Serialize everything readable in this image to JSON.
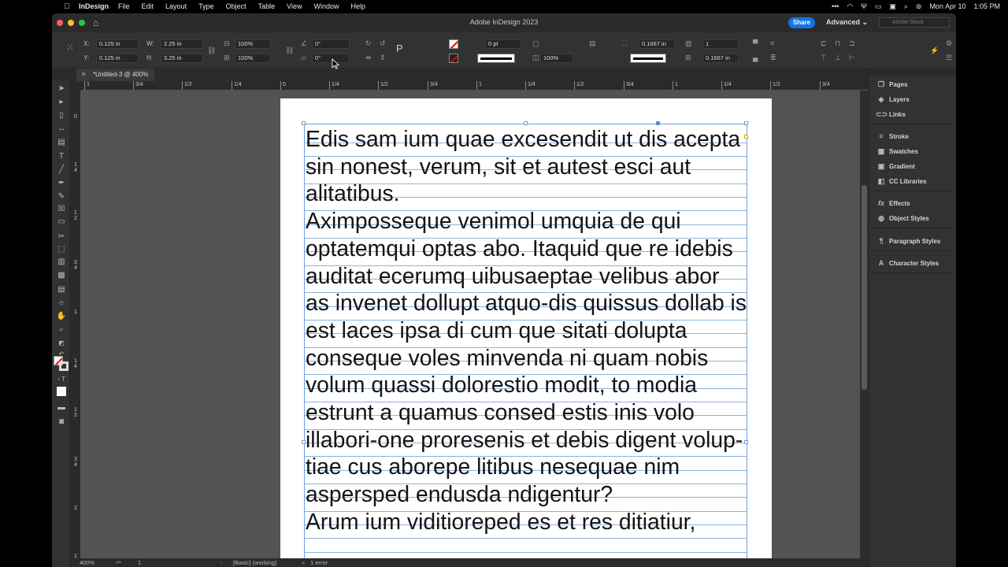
{
  "menubar": {
    "apple": "",
    "app": "InDesign",
    "items": [
      "File",
      "Edit",
      "Layout",
      "Type",
      "Object",
      "Table",
      "View",
      "Window",
      "Help"
    ],
    "clock": "Mon Apr 10",
    "time": "1:05 PM",
    "status_icons": [
      "more-icon",
      "wifi-icon",
      "airdrop-icon",
      "battery-icon",
      "screen-icon",
      "search-icon",
      "control-center-icon",
      "siri-icon"
    ]
  },
  "window": {
    "title": "Adobe InDesign 2023",
    "share_label": "Share",
    "workspace_label": "Advanced",
    "stock_placeholder": "Adobe Stock"
  },
  "controlbar": {
    "x_label": "X:",
    "x_value": "0.125 in",
    "y_label": "Y:",
    "y_value": "0.125 in",
    "w_label": "W:",
    "w_value": "2.25 in",
    "h_label": "H:",
    "h_value": "3.25 in",
    "scale_x": "100%",
    "scale_y": "100%",
    "rotate": "0°",
    "shear": "0°",
    "stroke_weight": "0 pt",
    "opacity": "100%",
    "offset_top": "0.1667 in",
    "offset_bottom": "0.1667 in",
    "columns": "1"
  },
  "document": {
    "tab_label": "*Untitled-3 @ 400%"
  },
  "ruler": {
    "h_labels": [
      "1",
      "3/4",
      "1/2",
      "1/4",
      "0",
      "1/4",
      "1/2",
      "3/4",
      "1",
      "1/4",
      "1/2",
      "3/4",
      "1",
      "1/4",
      "1/2",
      "3/4"
    ],
    "v_labels": [
      "0",
      "1 4",
      "1 2",
      "3 4",
      "1",
      "1 4",
      "1 2",
      "3 4",
      "2",
      "1 4"
    ]
  },
  "text_frame": {
    "paragraphs": [
      "Edis sam ium quae excesendit ut dis acepta sin nonest, verum, sit et autest esci aut alitatibus.",
      "Aximposseque venimol umquia de qui optatemqui optas abo. Itaquid que re idebis auditat ecerumq uibusaeptae velibus abor as invenet dollupt atquo-dis quissus dollab is est laces ipsa di cum que sitati dolupta conseque voles minvenda ni quam nobis volum quassi dolorestio modit, to modia estrunt a quamus consed estis inis volo illabori-one proresenis et debis digent volup-tiae cus aborepe litibus nesequae nim aspersped endusda ndigentur?",
      "Arum ium viditioreped es et res ditiatiur,"
    ]
  },
  "statusbar": {
    "zoom": "400%",
    "page": "1",
    "profile": "[Basic] (working)",
    "errors": "1 error"
  },
  "panels": {
    "groups": [
      [
        {
          "label": "Pages",
          "icon": "pages-icon",
          "glyph": "❐"
        },
        {
          "label": "Layers",
          "icon": "layers-icon",
          "glyph": "◈"
        },
        {
          "label": "Links",
          "icon": "links-icon",
          "glyph": "⊂⊃"
        }
      ],
      [
        {
          "label": "Stroke",
          "icon": "stroke-icon",
          "glyph": "≡"
        },
        {
          "label": "Swatches",
          "icon": "swatches-icon",
          "glyph": "▦"
        },
        {
          "label": "Gradient",
          "icon": "gradient-icon",
          "glyph": "▣"
        },
        {
          "label": "CC Libraries",
          "icon": "cc-libraries-icon",
          "glyph": "◧"
        }
      ],
      [
        {
          "label": "Effects",
          "icon": "effects-icon",
          "glyph": "fx"
        },
        {
          "label": "Object Styles",
          "icon": "object-styles-icon",
          "glyph": "◍"
        }
      ],
      [
        {
          "label": "Paragraph Styles",
          "icon": "paragraph-styles-icon",
          "glyph": "¶"
        }
      ],
      [
        {
          "label": "Character Styles",
          "icon": "character-styles-icon",
          "glyph": "A"
        }
      ]
    ]
  }
}
